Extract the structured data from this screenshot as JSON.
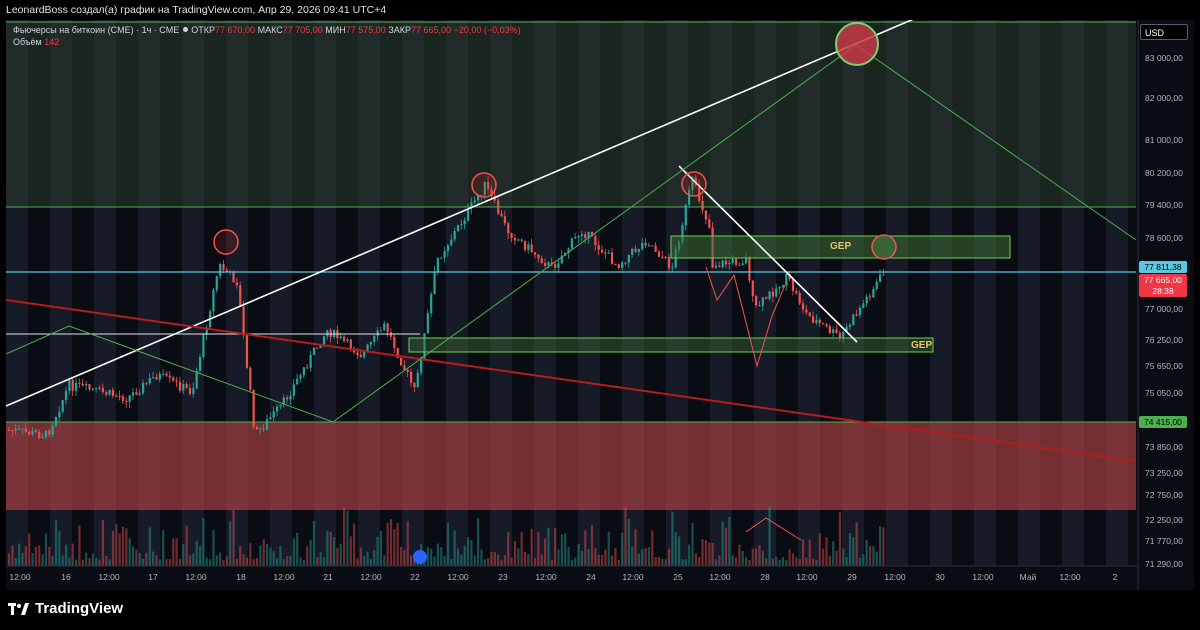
{
  "header": {
    "attribution": "LeonardBoss создал(а) график на TradingView.com, Апр 29, 2026 09:41 UTC+4"
  },
  "legend": {
    "symbol": "Фьючерсы на биткоин (CME) · 1ч · CME",
    "open_label": "ОТКР",
    "open_value": "77 670,00",
    "high_label": "МАКС",
    "high_value": "77 705,00",
    "low_label": "МИН",
    "low_value": "77 575,00",
    "close_label": "ЗАКР",
    "close_value": "77 665,00",
    "change": "−20,00 (−0,03%)",
    "volume_label": "Объём",
    "volume_value": "142"
  },
  "currency": "USD",
  "price_ticks": [
    "83 000,00",
    "82 000,00",
    "81 000,00",
    "80 200,00",
    "79 400,00",
    "78 600,00",
    "77 000,00",
    "76 250,00",
    "75 650,00",
    "75 050,00",
    "73 850,00",
    "73 250,00",
    "72 750,00",
    "72 250,00",
    "71 770,00",
    "71 290,00"
  ],
  "time_ticks": [
    "12:00",
    "16",
    "12:00",
    "17",
    "12:00",
    "18",
    "12:00",
    "21",
    "12:00",
    "22",
    "12:00",
    "23",
    "12:00",
    "24",
    "12:00",
    "25",
    "12:00",
    "28",
    "12:00",
    "29",
    "12:00",
    "30",
    "12:00",
    "Май",
    "12:00",
    "2"
  ],
  "badges": {
    "level_cyan": "77 811,38",
    "last_price": "77 665,00",
    "countdown": "28:38",
    "level_green": "74 415,00"
  },
  "annotations": {
    "gep_upper": "GEP",
    "gep_lower": "GEP"
  },
  "colors": {
    "up": "#26a69a",
    "down": "#ef5350",
    "cyan_line": "#5ac8e0",
    "green_line": "#4caf50",
    "red_zone": "#c24a4d",
    "trend_red": "#b71c1c"
  },
  "footer": {
    "logo_text": "TradingView"
  }
}
